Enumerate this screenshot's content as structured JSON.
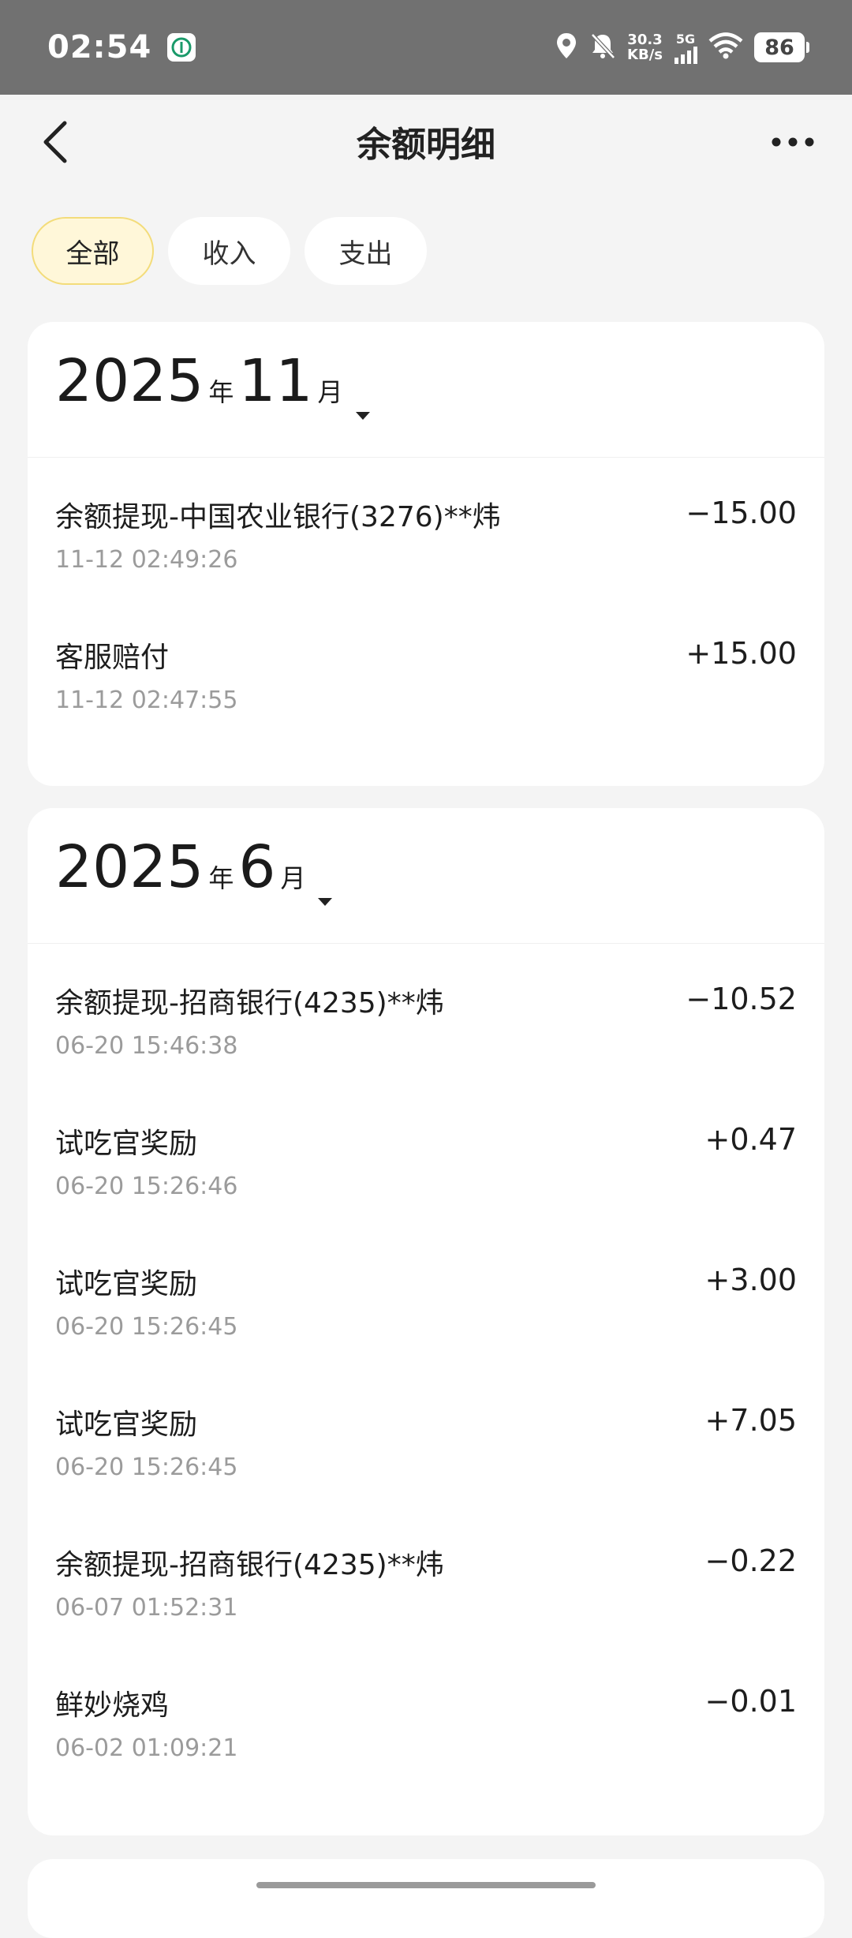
{
  "status_bar": {
    "time": "02:54",
    "net_speed_value": "30.3",
    "net_speed_unit": "KB/s",
    "network": "5G",
    "battery": "86"
  },
  "nav": {
    "title": "余额明细",
    "back_icon": "chevron-left-icon",
    "more_icon": "more-dots-icon"
  },
  "tabs": [
    {
      "label": "全部",
      "active": true
    },
    {
      "label": "收入",
      "active": false
    },
    {
      "label": "支出",
      "active": false
    }
  ],
  "groups": [
    {
      "year": "2025",
      "year_unit": "年",
      "month": "11",
      "month_unit": "月",
      "items": [
        {
          "title": "余额提现-中国农业银行(3276)**炜",
          "time": "11-12 02:49:26",
          "amount": "−15.00"
        },
        {
          "title": "客服赔付",
          "time": "11-12 02:47:55",
          "amount": "+15.00"
        }
      ]
    },
    {
      "year": "2025",
      "year_unit": "年",
      "month": "6",
      "month_unit": "月",
      "items": [
        {
          "title": "余额提现-招商银行(4235)**炜",
          "time": "06-20 15:46:38",
          "amount": "−10.52"
        },
        {
          "title": "试吃官奖励",
          "time": "06-20 15:26:46",
          "amount": "+0.47"
        },
        {
          "title": "试吃官奖励",
          "time": "06-20 15:26:45",
          "amount": "+3.00"
        },
        {
          "title": "试吃官奖励",
          "time": "06-20 15:26:45",
          "amount": "+7.05"
        },
        {
          "title": "余额提现-招商银行(4235)**炜",
          "time": "06-07 01:52:31",
          "amount": "−0.22"
        },
        {
          "title": "鲜妙烧鸡",
          "time": "06-02 01:09:21",
          "amount": "−0.01"
        }
      ]
    }
  ],
  "colors": {
    "status_bar_bg": "#717171",
    "page_bg": "#f4f4f4",
    "active_tab_bg": "#fff7d9",
    "active_tab_border": "#f3dc7a",
    "time_text": "#9b9b9b"
  }
}
